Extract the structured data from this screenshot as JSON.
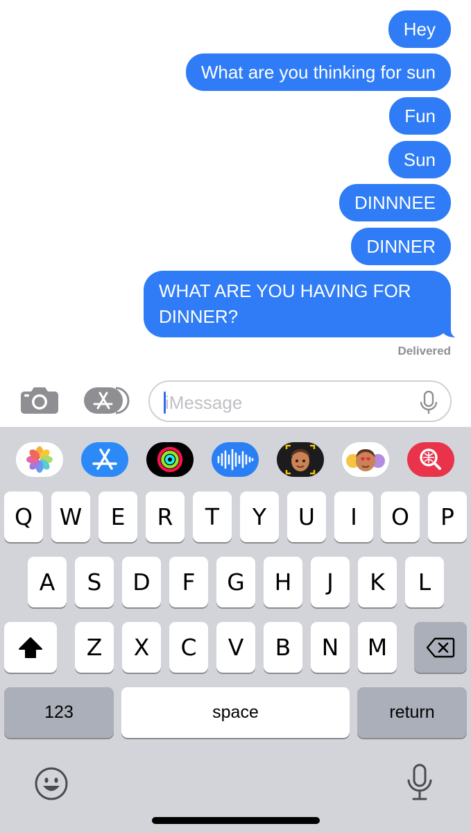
{
  "messages": [
    {
      "text": "Hey"
    },
    {
      "text": "What are you thinking for sun"
    },
    {
      "text": "Fun"
    },
    {
      "text": "Sun"
    },
    {
      "text": "DINNNEE"
    },
    {
      "text": "DINNER"
    },
    {
      "text": "WHAT ARE YOU HAVING FOR DINNER?"
    }
  ],
  "status": "Delivered",
  "input": {
    "placeholder": "iMessage",
    "value": ""
  },
  "input_icons": [
    "camera-icon",
    "app-store-icon",
    "microphone-icon"
  ],
  "app_drawer": [
    {
      "icon": "photos-icon"
    },
    {
      "icon": "app-store-icon"
    },
    {
      "icon": "activity-rings-icon"
    },
    {
      "icon": "audio-message-icon"
    },
    {
      "icon": "memoji-camera-icon"
    },
    {
      "icon": "memoji-stickers-icon"
    },
    {
      "icon": "image-search-icon"
    }
  ],
  "keyboard": {
    "row1": [
      "Q",
      "W",
      "E",
      "R",
      "T",
      "Y",
      "U",
      "I",
      "O",
      "P"
    ],
    "row2": [
      "A",
      "S",
      "D",
      "F",
      "G",
      "H",
      "J",
      "K",
      "L"
    ],
    "row3": [
      "Z",
      "X",
      "C",
      "V",
      "B",
      "N",
      "M"
    ],
    "numbers_label": "123",
    "space_label": "space",
    "return_label": "return",
    "shift_icon": "shift-icon",
    "delete_icon": "delete-icon",
    "emoji_icon": "emoji-icon",
    "dictation_icon": "microphone-icon"
  },
  "colors": {
    "bubble": "#2f7cf6",
    "keyboard_bg": "#d2d4d9",
    "dark_key": "#abafb9",
    "caret": "#2f6bf0"
  }
}
